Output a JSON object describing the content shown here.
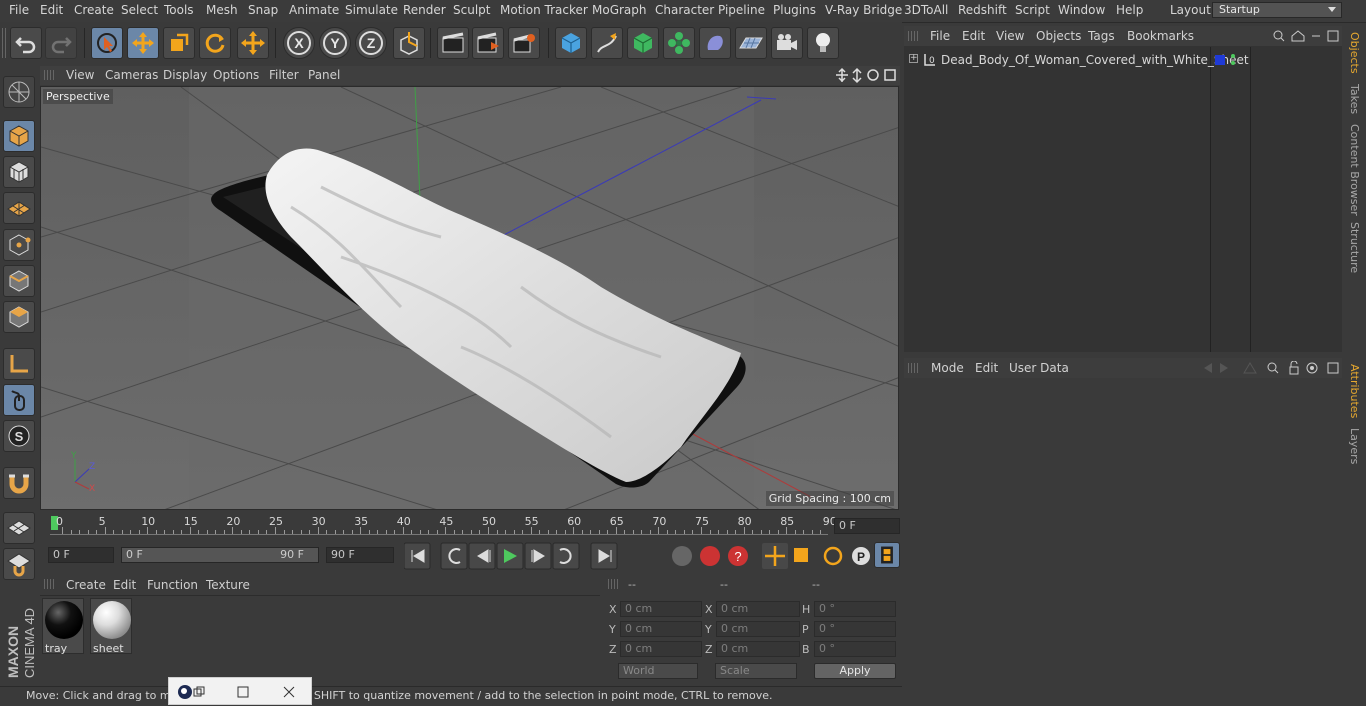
{
  "menubar": {
    "items": [
      "File",
      "Edit",
      "Create",
      "Select",
      "Tools",
      "Mesh",
      "Snap",
      "Animate",
      "Simulate",
      "Render",
      "Sculpt",
      "Motion Tracker",
      "MoGraph",
      "Character",
      "Pipeline",
      "Plugins",
      "V-Ray Bridge",
      "3DToAll",
      "Redshift",
      "Script",
      "Window",
      "Help"
    ],
    "layout_label": "Layout:",
    "layout_value": "Startup"
  },
  "toolbar": {
    "axis_x": "X",
    "axis_y": "Y",
    "axis_z": "Z",
    "icons": [
      "undo-icon",
      "redo-icon",
      "live-select-icon",
      "move-icon",
      "scale-icon",
      "rotate-icon",
      "transform-icon",
      "x-axis-icon",
      "y-axis-icon",
      "z-axis-icon",
      "coordinate-system-icon",
      "render-view-icon",
      "render-picture-viewer-icon",
      "edit-render-settings-icon",
      "cube-icon",
      "pen-icon",
      "subdivision-icon",
      "cloner-icon",
      "deformer-icon",
      "floor-icon",
      "camera-icon",
      "light-icon"
    ]
  },
  "viewport": {
    "menu": [
      "View",
      "Cameras",
      "Display",
      "Options",
      "Filter",
      "Panel"
    ],
    "label": "Perspective",
    "grid_spacing": "Grid Spacing : 100 cm"
  },
  "timeline": {
    "ticks": [
      "0",
      "5",
      "10",
      "15",
      "20",
      "25",
      "30",
      "35",
      "40",
      "45",
      "50",
      "55",
      "60",
      "65",
      "70",
      "75",
      "80",
      "85",
      "90"
    ],
    "current_frame": "0 F",
    "start_field": "0 F",
    "range_start": "0 F",
    "range_end": "90 F",
    "end_field": "90 F"
  },
  "materials": {
    "menu": [
      "Create",
      "Edit",
      "Function",
      "Texture"
    ],
    "items": [
      {
        "name": "tray"
      },
      {
        "name": "sheet"
      }
    ]
  },
  "coordinates": {
    "headers": [
      "--",
      "--",
      "--"
    ],
    "rows": [
      {
        "a": "X",
        "av": "0 cm",
        "b": "X",
        "bv": "0 cm",
        "c": "H",
        "cv": "0 °"
      },
      {
        "a": "Y",
        "av": "0 cm",
        "b": "Y",
        "bv": "0 cm",
        "c": "P",
        "cv": "0 °"
      },
      {
        "a": "Z",
        "av": "0 cm",
        "b": "Z",
        "bv": "0 cm",
        "c": "B",
        "cv": "0 °"
      }
    ],
    "world": "World",
    "scale": "Scale",
    "apply": "Apply"
  },
  "objects": {
    "menu": [
      "File",
      "Edit",
      "View",
      "Objects",
      "Tags",
      "Bookmarks"
    ],
    "items": [
      {
        "name": "Dead_Body_Of_Woman_Covered_with_White_Sheet"
      }
    ]
  },
  "attributes": {
    "menu": [
      "Mode",
      "Edit",
      "User Data"
    ]
  },
  "right_tabs": [
    "Objects",
    "Takes",
    "Content Browser",
    "Structure",
    "Attributes",
    "Layers"
  ],
  "status": "Move: Click and drag to move elements. Hold down SHIFT to quantize movement / add to the selection in point mode, CTRL to remove.",
  "brand": {
    "line1": "MAXON",
    "line2": "CINEMA 4D"
  }
}
